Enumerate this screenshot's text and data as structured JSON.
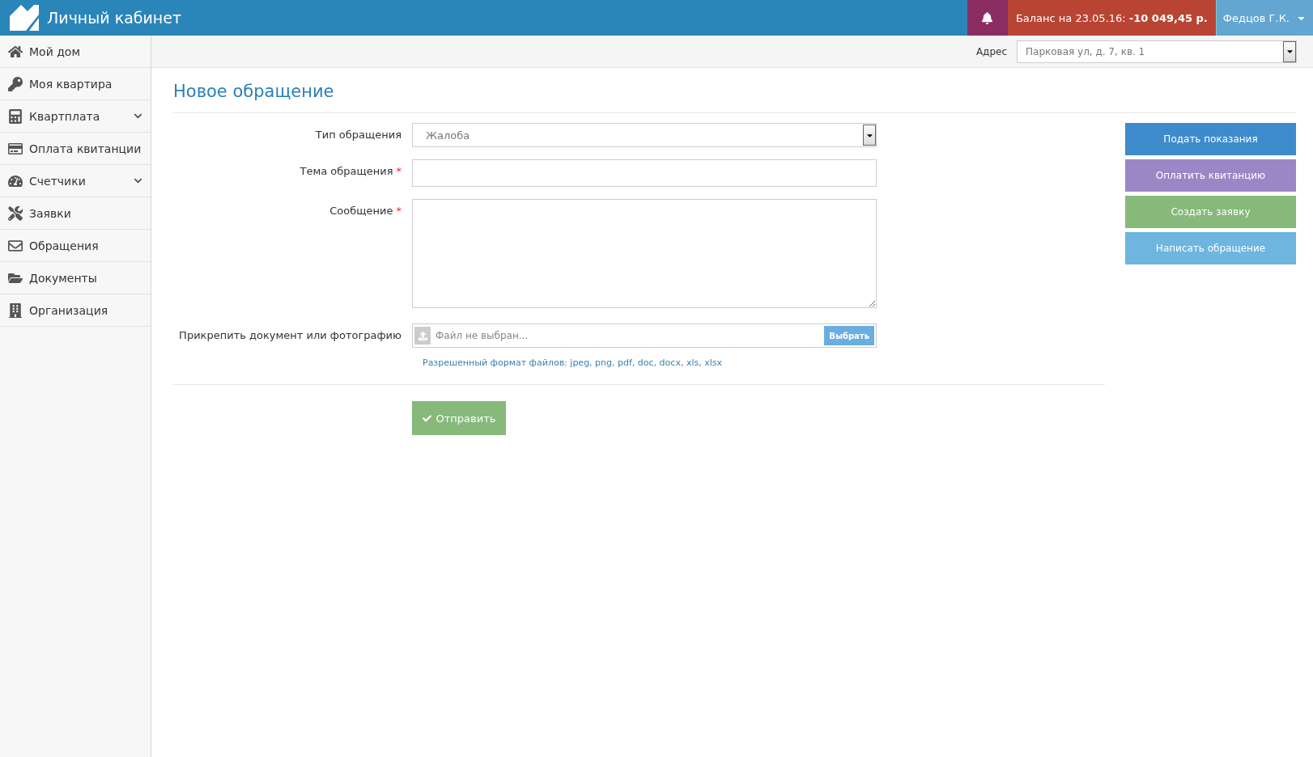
{
  "header": {
    "title": "Личный кабинет",
    "balance_label": "Баланс на 23.05.16:",
    "balance_value": "-10 049,45 р.",
    "user": "Федцов Г.К."
  },
  "sidebar": {
    "items": [
      {
        "label": "Мой дом",
        "kind": "link"
      },
      {
        "label": "Моя квартира",
        "kind": "link"
      },
      {
        "label": "Квартплата",
        "kind": "group"
      },
      {
        "label": "Оплата квитанции",
        "kind": "link"
      },
      {
        "label": "Счетчики",
        "kind": "group"
      },
      {
        "label": "Заявки",
        "kind": "link"
      },
      {
        "label": "Обращения",
        "kind": "link"
      },
      {
        "label": "Документы",
        "kind": "link"
      },
      {
        "label": "Организация",
        "kind": "link"
      }
    ]
  },
  "address": {
    "label": "Адрес",
    "value": "Парковая ул, д. 7, кв. 1"
  },
  "page_title": "Новое обращение",
  "form": {
    "required_mark": "*",
    "fields": [
      {
        "label": "Тип обращения",
        "kind": "select",
        "value": "Жалоба",
        "required": false
      },
      {
        "label": "Тема обращения",
        "kind": "text",
        "required": true
      },
      {
        "label": "Сообщение",
        "kind": "textarea",
        "required": true
      },
      {
        "label": "Прикрепить документ или фотографию",
        "kind": "file",
        "placeholder": "Файл не выбран...",
        "button": "Выбрать",
        "required": false
      }
    ],
    "hint": "Разрешенный формат файлов: jpeg, png, pdf, doc, docx, xls, xlsx",
    "submit": "Отправить"
  },
  "actions": [
    {
      "label": "Подать показания",
      "color": "#3d8bcd"
    },
    {
      "label": "Оплатить квитанцию",
      "color": "#9b87c6"
    },
    {
      "label": "Создать заявку",
      "color": "#86b97a"
    },
    {
      "label": "Написать обращение",
      "color": "#6eb5e0"
    }
  ]
}
